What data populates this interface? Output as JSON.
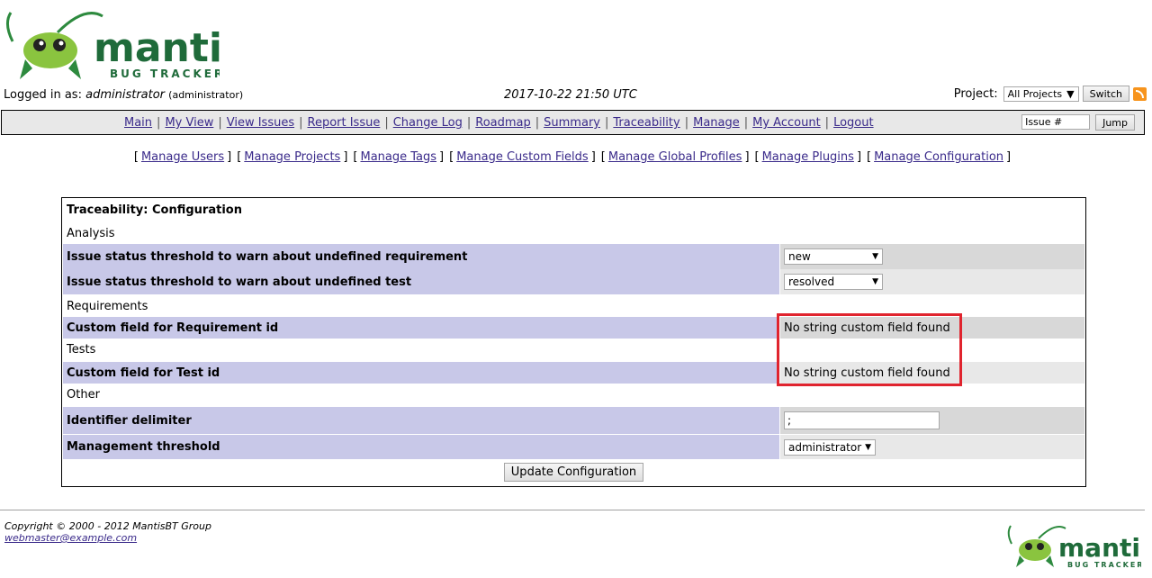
{
  "header": {
    "logo_word": "mantis",
    "logo_sub": "BUG TRACKER",
    "logged_in_label": "Logged in as:",
    "username": "administrator",
    "role": "(administrator)",
    "datetime": "2017-10-22 21:50 UTC",
    "project_label": "Project:",
    "project_selected": "All Projects",
    "switch_label": "Switch",
    "rss_icon": "rss-icon"
  },
  "menu": {
    "items": [
      "Main",
      "My View",
      "View Issues",
      "Report Issue",
      "Change Log",
      "Roadmap",
      "Summary",
      "Traceability",
      "Manage",
      "My Account",
      "Logout"
    ],
    "separator": "|",
    "issue_placeholder": "Issue #",
    "jump_label": "Jump"
  },
  "sub_menu": {
    "items": [
      "Manage Users",
      "Manage Projects",
      "Manage Tags",
      "Manage Custom Fields",
      "Manage Global Profiles",
      "Manage Plugins",
      "Manage Configuration"
    ],
    "open": "[",
    "close": "]"
  },
  "config": {
    "title": "Traceability: Configuration",
    "sections": {
      "analysis": "Analysis",
      "requirements": "Requirements",
      "tests": "Tests",
      "other": "Other"
    },
    "rows": {
      "req_threshold": {
        "label": "Issue status threshold to warn about undefined requirement",
        "value": "new"
      },
      "test_threshold": {
        "label": "Issue status threshold to warn about undefined test",
        "value": "resolved"
      },
      "req_field": {
        "label": "Custom field for Requirement id",
        "value": "No string custom field found"
      },
      "test_field": {
        "label": "Custom field for Test id",
        "value": "No string custom field found"
      },
      "delimiter": {
        "label": "Identifier delimiter",
        "value": ";"
      },
      "mgmt_threshold": {
        "label": "Management threshold",
        "value": "administrator"
      }
    },
    "update_label": "Update Configuration",
    "highlight_color": "#e0242e"
  },
  "footer": {
    "copyright": "Copyright © 2000 - 2012 MantisBT Group",
    "email": "webmaster@example.com"
  },
  "colors": {
    "label_bg": "#c8c8e8",
    "value_dark": "#d8d8d8",
    "value_light": "#e8e8e8",
    "menu_bg": "#e8e8e8",
    "link": "#3a2a8a",
    "logo_green": "#1f6b3a"
  }
}
